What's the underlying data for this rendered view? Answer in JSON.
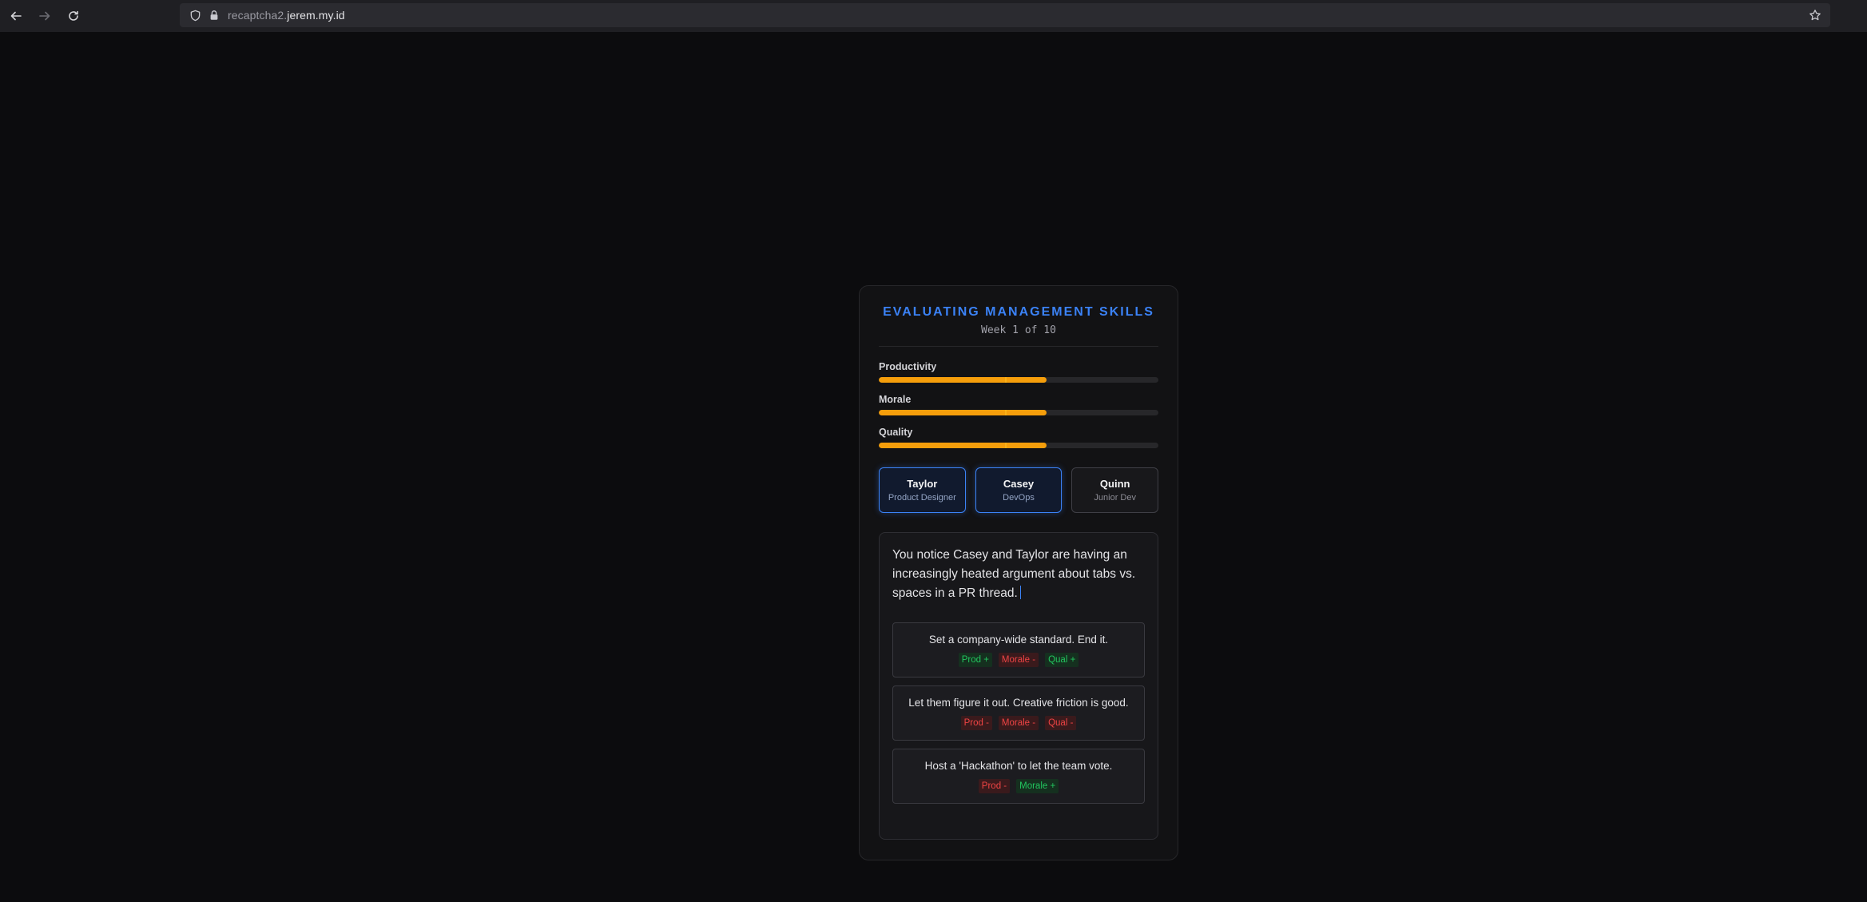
{
  "browser": {
    "url_prefix": "recaptcha2.",
    "url_domain": "jerem.my.id"
  },
  "game": {
    "title": "EVALUATING MANAGEMENT SKILLS",
    "week_label": "Week 1 of 10"
  },
  "stats": [
    {
      "label": "Productivity",
      "value_percent": 60,
      "marker_percent": 45
    },
    {
      "label": "Morale",
      "value_percent": 60,
      "marker_percent": 45
    },
    {
      "label": "Quality",
      "value_percent": 60,
      "marker_percent": 45
    }
  ],
  "team": [
    {
      "name": "Taylor",
      "role": "Product Designer",
      "active": true
    },
    {
      "name": "Casey",
      "role": "DevOps",
      "active": true
    },
    {
      "name": "Quinn",
      "role": "Junior Dev",
      "active": false
    }
  ],
  "scenario": {
    "prompt": "You notice Casey and Taylor are having an increasingly heated argument about tabs vs. spaces in a PR thread.",
    "choices": [
      {
        "text": "Set a company-wide standard. End it.",
        "effects": [
          {
            "label": "Prod +",
            "sentiment": "pos"
          },
          {
            "label": "Morale -",
            "sentiment": "neg"
          },
          {
            "label": "Qual +",
            "sentiment": "pos"
          }
        ]
      },
      {
        "text": "Let them figure it out. Creative friction is good.",
        "effects": [
          {
            "label": "Prod -",
            "sentiment": "neg"
          },
          {
            "label": "Morale -",
            "sentiment": "neg"
          },
          {
            "label": "Qual -",
            "sentiment": "neg"
          }
        ]
      },
      {
        "text": "Host a 'Hackathon' to let the team vote.",
        "effects": [
          {
            "label": "Prod -",
            "sentiment": "neg"
          },
          {
            "label": "Morale +",
            "sentiment": "pos"
          }
        ]
      }
    ]
  },
  "colors": {
    "accent": "#3b82f6",
    "bar_fill": "#f59e0b",
    "positive": "#22c55e",
    "negative": "#ef4444"
  }
}
